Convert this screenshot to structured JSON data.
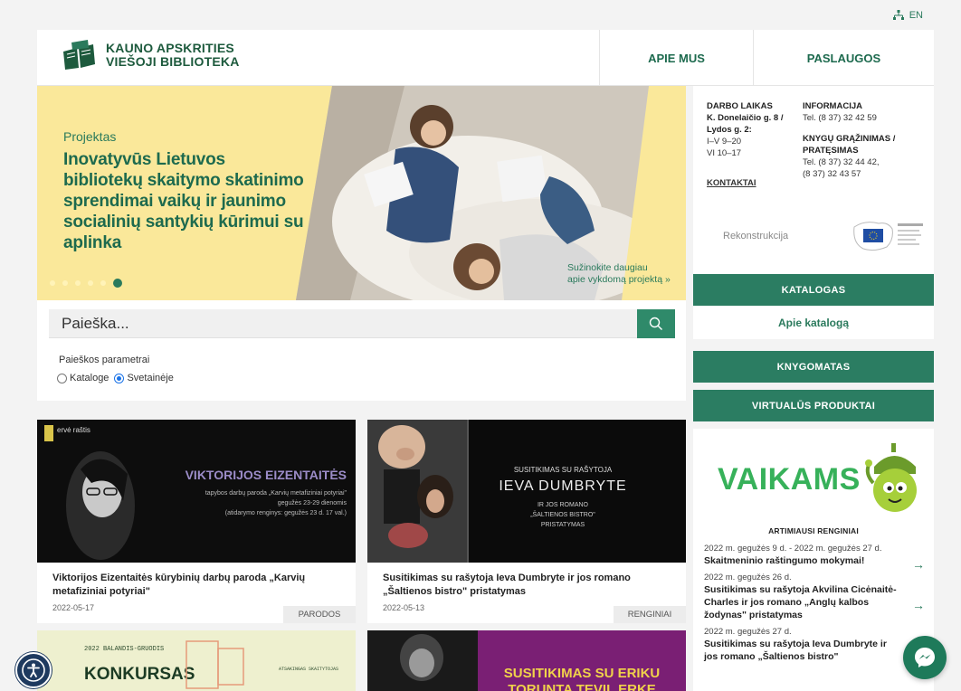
{
  "topbar": {
    "lang": "EN",
    "sitemap_icon": "sitemap-icon"
  },
  "logo": {
    "line1": "KAUNO APSKRITIES",
    "line2": "VIEŠOJI BIBLIOTEKA",
    "icon": "book-logo-icon"
  },
  "nav": {
    "apie": "APIE MUS",
    "paslaugos": "PASLAUGOS"
  },
  "hero": {
    "kicker": "Projektas",
    "title": "Inovatyvūs Lietuvos bibliotekų skaitymo skatinimo sprendimai vaikų ir jaunimo socialinių santykių kūrimui su aplinka",
    "more_line1": "Sužinokite daugiau",
    "more_line2": "apie vykdomą projektą »",
    "slides_total": 6,
    "active_slide": 6
  },
  "search": {
    "placeholder": "Paieška...",
    "params_label": "Paieškos parametrai",
    "option1": "Kataloge",
    "option2": "Svetainėje",
    "selected": "Svetainėje"
  },
  "info": {
    "hours_title": "DARBO LAIKAS",
    "address": "K. Donelaičio g. 8 / Lydos g. 2:",
    "hours1": "I–V 9–20",
    "hours2": "VI 10–17",
    "contacts": "KONTAKTAI",
    "info_title": "INFORMACIJA",
    "info_tel": "Tel. (8 37) 32 42 59",
    "return_title": "KNYGŲ GRĄŽINIMAS / PRATĘSIMAS",
    "return_tel1": "Tel. (8 37) 32 44 42,",
    "return_tel2": "(8 37) 32 43 57",
    "rekon": "Rekonstrukcija"
  },
  "sidebar": {
    "katalogas": "KATALOGAS",
    "apie_katalog": "Apie katalogą",
    "knygomatas": "KNYGOMATAS",
    "virtualus": "VIRTUALŪS PRODUKTAI"
  },
  "vaikams": {
    "title": "VAIKAMS",
    "events_head": "ARTIMIAUSI RENGINIAI",
    "events": [
      {
        "date": "2022 m. gegužės 9 d. - 2022 m. gegužės 27 d.",
        "title": "Skaitmeninio raštingumo mokymai!"
      },
      {
        "date": "2022 m. gegužės 26 d.",
        "title": "Susitikimas su rašytoja Akvilina Cicėnaitė-Charles ir jos romano „Anglų kalbos žodynas\" pristatymas"
      },
      {
        "date": "2022 m. gegužės 27 d.",
        "title": "Susitikimas su rašytoja Ieva Dumbryte ir jos romano „Šaltienos bistro\""
      }
    ]
  },
  "cards": [
    {
      "img_logo": "ervė raštis",
      "img_title": "VIKTORIJOS EIZENTAITĖS",
      "img_sub1": "tapybos darbų paroda „Karvių metafiziniai potyriai\"",
      "img_sub2": "gegužės 23-29 dienomis",
      "img_sub3": "(atidarymo renginys: gegužės 23 d. 17 val.)",
      "title": "Viktorijos Eizentaitės kūrybinių darbų paroda „Karvių metafiziniai potyriai\"",
      "date": "2022-05-17",
      "tag": "PARODOS"
    },
    {
      "img_l1": "SUSITIKIMAS SU RAŠYTOJA",
      "img_l2": "IEVA DUMBRYTE",
      "img_l3": "IR JOS ROMANO",
      "img_l4": "„ŠALTIENOS BISTRO\"",
      "img_l5": "PRISTATYMAS",
      "title": "Susitikimas su rašytoja Ieva Dumbryte ir jos romano „Šaltienos bistro\" pristatymas",
      "date": "2022-05-13",
      "tag": "RENGINIAI"
    },
    {
      "img_l1": "2022 BALANDIS-GRUODIS",
      "img_l2": "KONKURSAS",
      "img_l3": "ATSAKINGAS SKAITYTOJAS"
    },
    {
      "img_l1": "SUSITIKIMAS SU ERIKU",
      "img_l2": "TORUNTA TEVIL ERKE"
    }
  ],
  "colors": {
    "green": "#2b7d62",
    "yellow": "#fae89a",
    "brand": "#1d5a3d"
  }
}
